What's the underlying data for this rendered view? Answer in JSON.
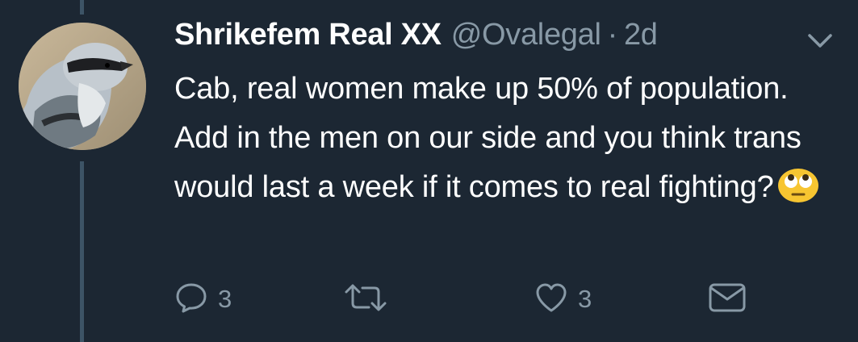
{
  "tweet": {
    "display_name": "Shrikefem Real XX",
    "handle": "@Ovalegal",
    "separator": "·",
    "time": "2d",
    "text": "Cab, real women make up 50% of population. Add in the men on our side and you think trans would last a week if it comes to real fighting?",
    "emoji": "face-with-rolling-eyes"
  },
  "actions": {
    "reply_count": "3",
    "like_count": "3"
  },
  "icons": {
    "avatar": "shrike-bird-avatar",
    "menu": "chevron-down-icon",
    "reply": "reply-icon",
    "retweet": "retweet-icon",
    "like": "heart-icon",
    "dm": "envelope-icon"
  },
  "colors": {
    "background": "#1c2733",
    "text": "#ffffff",
    "secondary": "#8899a6",
    "thread_line": "#3d5466"
  }
}
